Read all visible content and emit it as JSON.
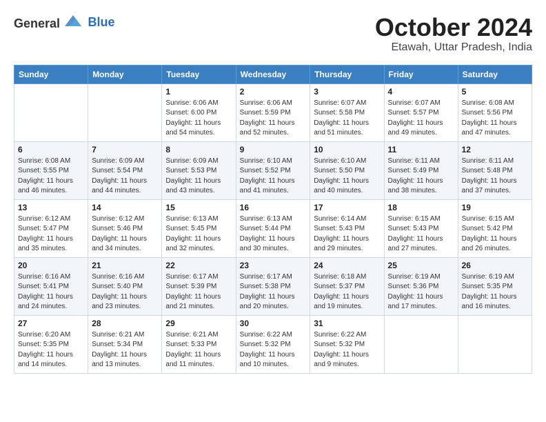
{
  "logo": {
    "general": "General",
    "blue": "Blue"
  },
  "title": "October 2024",
  "location": "Etawah, Uttar Pradesh, India",
  "days_of_week": [
    "Sunday",
    "Monday",
    "Tuesday",
    "Wednesday",
    "Thursday",
    "Friday",
    "Saturday"
  ],
  "weeks": [
    [
      {
        "day": "",
        "sunrise": "",
        "sunset": "",
        "daylight": ""
      },
      {
        "day": "",
        "sunrise": "",
        "sunset": "",
        "daylight": ""
      },
      {
        "day": "1",
        "sunrise": "Sunrise: 6:06 AM",
        "sunset": "Sunset: 6:00 PM",
        "daylight": "Daylight: 11 hours and 54 minutes."
      },
      {
        "day": "2",
        "sunrise": "Sunrise: 6:06 AM",
        "sunset": "Sunset: 5:59 PM",
        "daylight": "Daylight: 11 hours and 52 minutes."
      },
      {
        "day": "3",
        "sunrise": "Sunrise: 6:07 AM",
        "sunset": "Sunset: 5:58 PM",
        "daylight": "Daylight: 11 hours and 51 minutes."
      },
      {
        "day": "4",
        "sunrise": "Sunrise: 6:07 AM",
        "sunset": "Sunset: 5:57 PM",
        "daylight": "Daylight: 11 hours and 49 minutes."
      },
      {
        "day": "5",
        "sunrise": "Sunrise: 6:08 AM",
        "sunset": "Sunset: 5:56 PM",
        "daylight": "Daylight: 11 hours and 47 minutes."
      }
    ],
    [
      {
        "day": "6",
        "sunrise": "Sunrise: 6:08 AM",
        "sunset": "Sunset: 5:55 PM",
        "daylight": "Daylight: 11 hours and 46 minutes."
      },
      {
        "day": "7",
        "sunrise": "Sunrise: 6:09 AM",
        "sunset": "Sunset: 5:54 PM",
        "daylight": "Daylight: 11 hours and 44 minutes."
      },
      {
        "day": "8",
        "sunrise": "Sunrise: 6:09 AM",
        "sunset": "Sunset: 5:53 PM",
        "daylight": "Daylight: 11 hours and 43 minutes."
      },
      {
        "day": "9",
        "sunrise": "Sunrise: 6:10 AM",
        "sunset": "Sunset: 5:52 PM",
        "daylight": "Daylight: 11 hours and 41 minutes."
      },
      {
        "day": "10",
        "sunrise": "Sunrise: 6:10 AM",
        "sunset": "Sunset: 5:50 PM",
        "daylight": "Daylight: 11 hours and 40 minutes."
      },
      {
        "day": "11",
        "sunrise": "Sunrise: 6:11 AM",
        "sunset": "Sunset: 5:49 PM",
        "daylight": "Daylight: 11 hours and 38 minutes."
      },
      {
        "day": "12",
        "sunrise": "Sunrise: 6:11 AM",
        "sunset": "Sunset: 5:48 PM",
        "daylight": "Daylight: 11 hours and 37 minutes."
      }
    ],
    [
      {
        "day": "13",
        "sunrise": "Sunrise: 6:12 AM",
        "sunset": "Sunset: 5:47 PM",
        "daylight": "Daylight: 11 hours and 35 minutes."
      },
      {
        "day": "14",
        "sunrise": "Sunrise: 6:12 AM",
        "sunset": "Sunset: 5:46 PM",
        "daylight": "Daylight: 11 hours and 34 minutes."
      },
      {
        "day": "15",
        "sunrise": "Sunrise: 6:13 AM",
        "sunset": "Sunset: 5:45 PM",
        "daylight": "Daylight: 11 hours and 32 minutes."
      },
      {
        "day": "16",
        "sunrise": "Sunrise: 6:13 AM",
        "sunset": "Sunset: 5:44 PM",
        "daylight": "Daylight: 11 hours and 30 minutes."
      },
      {
        "day": "17",
        "sunrise": "Sunrise: 6:14 AM",
        "sunset": "Sunset: 5:43 PM",
        "daylight": "Daylight: 11 hours and 29 minutes."
      },
      {
        "day": "18",
        "sunrise": "Sunrise: 6:15 AM",
        "sunset": "Sunset: 5:43 PM",
        "daylight": "Daylight: 11 hours and 27 minutes."
      },
      {
        "day": "19",
        "sunrise": "Sunrise: 6:15 AM",
        "sunset": "Sunset: 5:42 PM",
        "daylight": "Daylight: 11 hours and 26 minutes."
      }
    ],
    [
      {
        "day": "20",
        "sunrise": "Sunrise: 6:16 AM",
        "sunset": "Sunset: 5:41 PM",
        "daylight": "Daylight: 11 hours and 24 minutes."
      },
      {
        "day": "21",
        "sunrise": "Sunrise: 6:16 AM",
        "sunset": "Sunset: 5:40 PM",
        "daylight": "Daylight: 11 hours and 23 minutes."
      },
      {
        "day": "22",
        "sunrise": "Sunrise: 6:17 AM",
        "sunset": "Sunset: 5:39 PM",
        "daylight": "Daylight: 11 hours and 21 minutes."
      },
      {
        "day": "23",
        "sunrise": "Sunrise: 6:17 AM",
        "sunset": "Sunset: 5:38 PM",
        "daylight": "Daylight: 11 hours and 20 minutes."
      },
      {
        "day": "24",
        "sunrise": "Sunrise: 6:18 AM",
        "sunset": "Sunset: 5:37 PM",
        "daylight": "Daylight: 11 hours and 19 minutes."
      },
      {
        "day": "25",
        "sunrise": "Sunrise: 6:19 AM",
        "sunset": "Sunset: 5:36 PM",
        "daylight": "Daylight: 11 hours and 17 minutes."
      },
      {
        "day": "26",
        "sunrise": "Sunrise: 6:19 AM",
        "sunset": "Sunset: 5:35 PM",
        "daylight": "Daylight: 11 hours and 16 minutes."
      }
    ],
    [
      {
        "day": "27",
        "sunrise": "Sunrise: 6:20 AM",
        "sunset": "Sunset: 5:35 PM",
        "daylight": "Daylight: 11 hours and 14 minutes."
      },
      {
        "day": "28",
        "sunrise": "Sunrise: 6:21 AM",
        "sunset": "Sunset: 5:34 PM",
        "daylight": "Daylight: 11 hours and 13 minutes."
      },
      {
        "day": "29",
        "sunrise": "Sunrise: 6:21 AM",
        "sunset": "Sunset: 5:33 PM",
        "daylight": "Daylight: 11 hours and 11 minutes."
      },
      {
        "day": "30",
        "sunrise": "Sunrise: 6:22 AM",
        "sunset": "Sunset: 5:32 PM",
        "daylight": "Daylight: 11 hours and 10 minutes."
      },
      {
        "day": "31",
        "sunrise": "Sunrise: 6:22 AM",
        "sunset": "Sunset: 5:32 PM",
        "daylight": "Daylight: 11 hours and 9 minutes."
      },
      {
        "day": "",
        "sunrise": "",
        "sunset": "",
        "daylight": ""
      },
      {
        "day": "",
        "sunrise": "",
        "sunset": "",
        "daylight": ""
      }
    ]
  ]
}
